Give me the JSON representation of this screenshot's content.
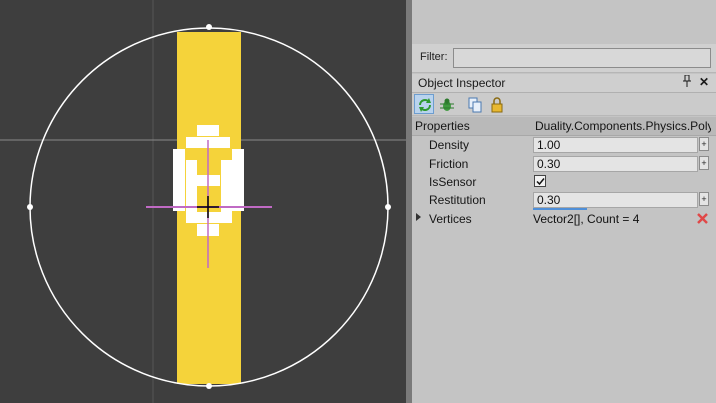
{
  "filter": {
    "label": "Filter:",
    "value": ""
  },
  "inspector": {
    "title": "Object Inspector",
    "pin_glyph": "📌",
    "close_glyph": "✕",
    "toolbar": [
      {
        "icon": "refresh-icon",
        "active": true
      },
      {
        "icon": "debug-bug-icon",
        "active": false
      },
      {
        "icon": "copy-icon",
        "active": false
      },
      {
        "icon": "lock-icon",
        "active": false
      }
    ],
    "header": {
      "col1": "Properties",
      "col2": "Duality.Components.Physics.Poly ..."
    },
    "properties": {
      "density": {
        "label": "Density",
        "value": "1.00"
      },
      "friction": {
        "label": "Friction",
        "value": "0.30"
      },
      "issensor": {
        "label": "IsSensor",
        "checked": true
      },
      "restitution": {
        "label": "Restitution",
        "value": "0.30"
      },
      "vertices": {
        "label": "Vertices",
        "value": "Vector2[], Count = 4"
      }
    },
    "spin_glyph": "+"
  },
  "colors": {
    "viewport_bg": "#3e3e3e",
    "sprite_yellow": "#f5d33a",
    "gizmo_pink": "#c06ac4",
    "delete_red": "#e04848"
  }
}
